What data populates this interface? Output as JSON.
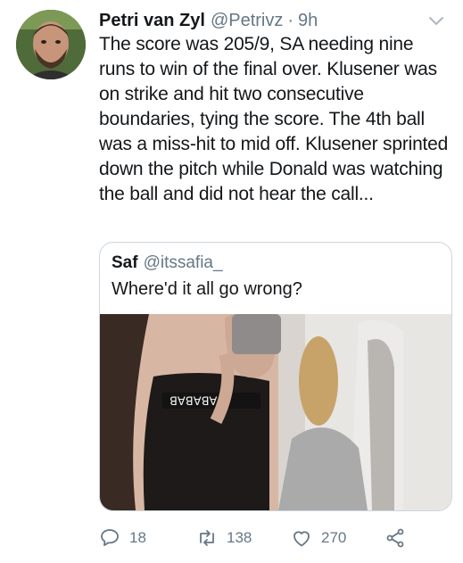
{
  "tweet": {
    "author_name": "Petri van Zyl",
    "author_handle": "@Petrivz",
    "separator": "·",
    "time": "9h",
    "text": "The score was 205/9, SA needing nine runs to win of the final over. Klusener was on strike and hit two consecutive boundaries, tying the score. The 4th ball was a miss-hit to mid off. Klusener sprinted down the pitch while Donald was watching the ball and did not hear the call...",
    "avatar_icon": "profile-photo"
  },
  "quote": {
    "author_name": "Saf",
    "author_handle": "@itssafia_",
    "text": "Where'd it all go wrong?",
    "media_icon": "photo"
  },
  "actions": {
    "replies": "18",
    "retweets": "138",
    "likes": "270",
    "icons": [
      "reply-icon",
      "retweet-icon",
      "like-icon",
      "share-icon"
    ]
  },
  "colors": {
    "text": "#14171a",
    "muted": "#657786",
    "border": "#ccd6dd"
  }
}
